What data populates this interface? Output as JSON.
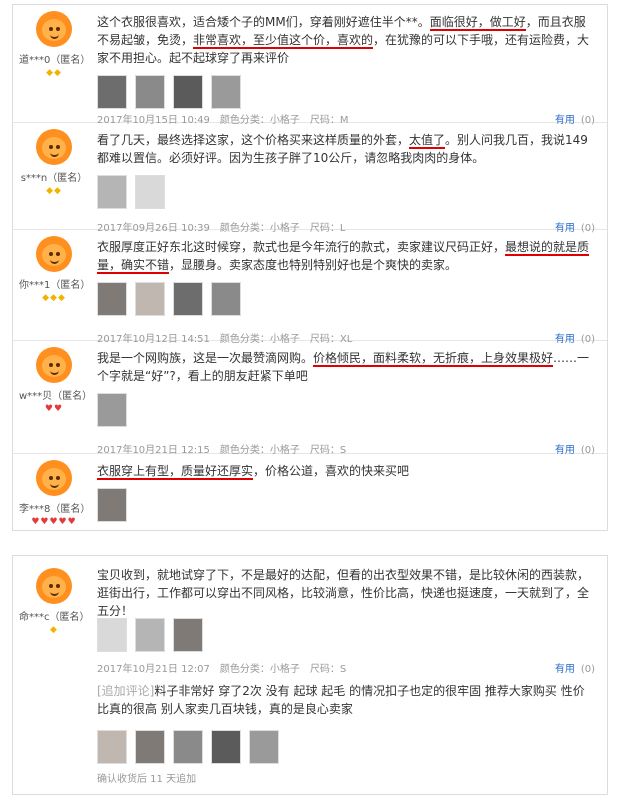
{
  "reviews": [
    {
      "user": "道***0（匿名）",
      "badge_type": "yellow",
      "badges": "◆◆",
      "text": [
        {
          "t": "这个衣服很喜欢，适合矮个子的MM们，穿着刚好遮住半个**。"
        },
        {
          "t": "面临很好，做工好",
          "hl": true
        },
        {
          "t": "，而且衣服不易起皱，免烫，"
        },
        {
          "t": "非常喜欢，至少值这个价，喜欢的",
          "hl": true
        },
        {
          "t": "，在犹豫的可以下手哦，还有运险费，大家不用担心。起不起球穿了再来评价"
        }
      ],
      "date": "2017年10月15日 10:49",
      "color": "颜色分类：小格子",
      "size": "尺码：M",
      "useful": "有用",
      "useful_count": "(0)"
    },
    {
      "user": "s***n（匿名）",
      "badge_type": "yellow",
      "badges": "◆◆",
      "text": [
        {
          "t": "看了几天，最终选择这家，这个价格买来这样质量的外套，"
        },
        {
          "t": "太值了",
          "hl": true
        },
        {
          "t": "。别人问我几百，我说149都难以置信。必须好评。因为生孩子胖了10公斤，请忽略我肉肉的身体。"
        }
      ],
      "date": "2017年09月26日 10:39",
      "color": "颜色分类：小格子",
      "size": "尺码：L",
      "useful": "有用",
      "useful_count": "(0)"
    },
    {
      "user": "你***1（匿名）",
      "badge_type": "yellow",
      "badges": "◆◆◆",
      "text": [
        {
          "t": "衣服厚度正好东北这时候穿，款式也是今年流行的款式，卖家建议尺码正好，"
        },
        {
          "t": "最想说的就是质量，确实不错",
          "hl": true
        },
        {
          "t": "，显腰身。卖家态度也特别特别好也是个爽快的卖家。"
        }
      ],
      "date": "2017年10月12日 14:51",
      "color": "颜色分类：小格子",
      "size": "尺码：XL",
      "useful": "有用",
      "useful_count": "(0)"
    },
    {
      "user": "w***贝（匿名）",
      "badge_type": "red",
      "badges": "♥♥",
      "text": [
        {
          "t": "我是一个网购族，这是一次最赞滴网购。"
        },
        {
          "t": "价格倾民，面料柔软，无折痕，上身效果极好",
          "hl": true
        },
        {
          "t": "……一个字就是“好”?，看上的朋友赶紧下单吧"
        }
      ],
      "date": "2017年10月21日 12:15",
      "color": "颜色分类：小格子",
      "size": "尺码：S",
      "useful": "有用",
      "useful_count": "(0)"
    },
    {
      "user": "李***8（匿名）",
      "badge_type": "red",
      "badges": "♥♥♥♥♥",
      "text": [
        {
          "t": "衣服穿上有型，质量好还厚实",
          "hl": true
        },
        {
          "t": "，价格公道，喜欢的快来买吧"
        }
      ],
      "date": "",
      "color": "",
      "size": "",
      "useful": "",
      "useful_count": ""
    }
  ],
  "review2": {
    "user": "命***c（匿名）",
    "badges": "◆",
    "text": "宝贝收到，就地试穿了下，不是最好的达配，但看的出衣型效果不错，是比较休闲的西装款，逛街出行，工作都可以穿出不同风格，比较淌意，性价比高，快递也挺速度，一天就到了，全五分！",
    "date": "2017年10月21日 12:07",
    "color": "颜色分类：小格子",
    "size": "尺码：S",
    "useful": "有用",
    "useful_count": "(0)",
    "followup_tag": "[追加评论]",
    "followup_text": "料子非常好 穿了2次 没有 起球 起毛 的情况扣子也定的很牢固 推荐大家购买 性价比真的很高 别人家卖几百块钱，真的是良心卖家",
    "followup_time": "确认收货后 11 天追加"
  }
}
